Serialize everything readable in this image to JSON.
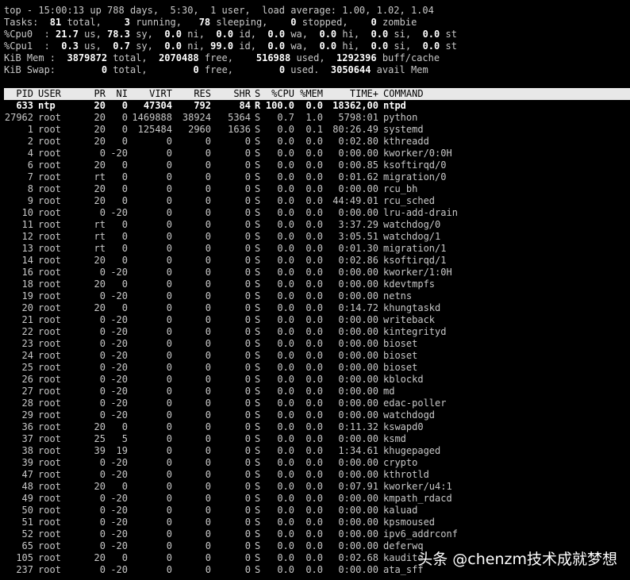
{
  "summary": [
    [
      {
        "t": "top - 15:00:13 up 788 days,  5:30,  1 user,  load average: 1.00, 1.02, 1.04"
      }
    ],
    [
      {
        "t": "Tasks: "
      },
      {
        "t": " 81",
        "b": 1
      },
      {
        "t": " total,  "
      },
      {
        "t": "  3",
        "b": 1
      },
      {
        "t": " running,  "
      },
      {
        "t": " 78",
        "b": 1
      },
      {
        "t": " sleeping,  "
      },
      {
        "t": "  0",
        "b": 1
      },
      {
        "t": " stopped,  "
      },
      {
        "t": "  0",
        "b": 1
      },
      {
        "t": " zombie"
      }
    ],
    [
      {
        "t": "%Cpu0  : "
      },
      {
        "t": "21.7",
        "b": 1
      },
      {
        "t": " us, "
      },
      {
        "t": "78.3",
        "b": 1
      },
      {
        "t": " sy,  "
      },
      {
        "t": "0.0",
        "b": 1
      },
      {
        "t": " ni,  "
      },
      {
        "t": "0.0",
        "b": 1
      },
      {
        "t": " id,  "
      },
      {
        "t": "0.0",
        "b": 1
      },
      {
        "t": " wa,  "
      },
      {
        "t": "0.0",
        "b": 1
      },
      {
        "t": " hi,  "
      },
      {
        "t": "0.0",
        "b": 1
      },
      {
        "t": " si,  "
      },
      {
        "t": "0.0",
        "b": 1
      },
      {
        "t": " st"
      }
    ],
    [
      {
        "t": "%Cpu1  :  "
      },
      {
        "t": "0.3",
        "b": 1
      },
      {
        "t": " us,  "
      },
      {
        "t": "0.7",
        "b": 1
      },
      {
        "t": " sy,  "
      },
      {
        "t": "0.0",
        "b": 1
      },
      {
        "t": " ni, "
      },
      {
        "t": "99.0",
        "b": 1
      },
      {
        "t": " id,  "
      },
      {
        "t": "0.0",
        "b": 1
      },
      {
        "t": " wa,  "
      },
      {
        "t": "0.0",
        "b": 1
      },
      {
        "t": " hi,  "
      },
      {
        "t": "0.0",
        "b": 1
      },
      {
        "t": " si,  "
      },
      {
        "t": "0.0",
        "b": 1
      },
      {
        "t": " st"
      }
    ],
    [
      {
        "t": "KiB Mem : "
      },
      {
        "t": " 3879872",
        "b": 1
      },
      {
        "t": " total, "
      },
      {
        "t": " 2070488",
        "b": 1
      },
      {
        "t": " free,  "
      },
      {
        "t": "  516988",
        "b": 1
      },
      {
        "t": " used, "
      },
      {
        "t": " 1292396",
        "b": 1
      },
      {
        "t": " buff/cache"
      }
    ],
    [
      {
        "t": "KiB Swap:        "
      },
      {
        "t": "0",
        "b": 1
      },
      {
        "t": " total,        "
      },
      {
        "t": "0",
        "b": 1
      },
      {
        "t": " free,        "
      },
      {
        "t": "0",
        "b": 1
      },
      {
        "t": " used. "
      },
      {
        "t": " 3050644",
        "b": 1
      },
      {
        "t": " avail Mem"
      }
    ]
  ],
  "columns": [
    "PID",
    "USER",
    "PR",
    "NI",
    "VIRT",
    "RES",
    "SHR",
    "S",
    "%CPU",
    "%MEM",
    "TIME+",
    "COMMAND"
  ],
  "processes": [
    [
      "633",
      "ntp",
      "20",
      "0",
      "47304",
      "792",
      "84",
      "R",
      "100.0",
      "0.0",
      "18362,00",
      "ntpd"
    ],
    [
      "27962",
      "root",
      "20",
      "0",
      "1469888",
      "38924",
      "5364",
      "S",
      "0.7",
      "1.0",
      "5798:01",
      "python"
    ],
    [
      "1",
      "root",
      "20",
      "0",
      "125484",
      "2960",
      "1636",
      "S",
      "0.0",
      "0.1",
      "80:26.49",
      "systemd"
    ],
    [
      "2",
      "root",
      "20",
      "0",
      "0",
      "0",
      "0",
      "S",
      "0.0",
      "0.0",
      "0:02.80",
      "kthreadd"
    ],
    [
      "4",
      "root",
      "0",
      "-20",
      "0",
      "0",
      "0",
      "S",
      "0.0",
      "0.0",
      "0:00.00",
      "kworker/0:0H"
    ],
    [
      "6",
      "root",
      "20",
      "0",
      "0",
      "0",
      "0",
      "S",
      "0.0",
      "0.0",
      "0:00.85",
      "ksoftirqd/0"
    ],
    [
      "7",
      "root",
      "rt",
      "0",
      "0",
      "0",
      "0",
      "S",
      "0.0",
      "0.0",
      "0:01.62",
      "migration/0"
    ],
    [
      "8",
      "root",
      "20",
      "0",
      "0",
      "0",
      "0",
      "S",
      "0.0",
      "0.0",
      "0:00.00",
      "rcu_bh"
    ],
    [
      "9",
      "root",
      "20",
      "0",
      "0",
      "0",
      "0",
      "S",
      "0.0",
      "0.0",
      "44:49.01",
      "rcu_sched"
    ],
    [
      "10",
      "root",
      "0",
      "-20",
      "0",
      "0",
      "0",
      "S",
      "0.0",
      "0.0",
      "0:00.00",
      "lru-add-drain"
    ],
    [
      "11",
      "root",
      "rt",
      "0",
      "0",
      "0",
      "0",
      "S",
      "0.0",
      "0.0",
      "3:37.29",
      "watchdog/0"
    ],
    [
      "12",
      "root",
      "rt",
      "0",
      "0",
      "0",
      "0",
      "S",
      "0.0",
      "0.0",
      "3:05.51",
      "watchdog/1"
    ],
    [
      "13",
      "root",
      "rt",
      "0",
      "0",
      "0",
      "0",
      "S",
      "0.0",
      "0.0",
      "0:01.30",
      "migration/1"
    ],
    [
      "14",
      "root",
      "20",
      "0",
      "0",
      "0",
      "0",
      "S",
      "0.0",
      "0.0",
      "0:02.86",
      "ksoftirqd/1"
    ],
    [
      "16",
      "root",
      "0",
      "-20",
      "0",
      "0",
      "0",
      "S",
      "0.0",
      "0.0",
      "0:00.00",
      "kworker/1:0H"
    ],
    [
      "18",
      "root",
      "20",
      "0",
      "0",
      "0",
      "0",
      "S",
      "0.0",
      "0.0",
      "0:00.00",
      "kdevtmpfs"
    ],
    [
      "19",
      "root",
      "0",
      "-20",
      "0",
      "0",
      "0",
      "S",
      "0.0",
      "0.0",
      "0:00.00",
      "netns"
    ],
    [
      "20",
      "root",
      "20",
      "0",
      "0",
      "0",
      "0",
      "S",
      "0.0",
      "0.0",
      "0:14.72",
      "khungtaskd"
    ],
    [
      "21",
      "root",
      "0",
      "-20",
      "0",
      "0",
      "0",
      "S",
      "0.0",
      "0.0",
      "0:00.00",
      "writeback"
    ],
    [
      "22",
      "root",
      "0",
      "-20",
      "0",
      "0",
      "0",
      "S",
      "0.0",
      "0.0",
      "0:00.00",
      "kintegrityd"
    ],
    [
      "23",
      "root",
      "0",
      "-20",
      "0",
      "0",
      "0",
      "S",
      "0.0",
      "0.0",
      "0:00.00",
      "bioset"
    ],
    [
      "24",
      "root",
      "0",
      "-20",
      "0",
      "0",
      "0",
      "S",
      "0.0",
      "0.0",
      "0:00.00",
      "bioset"
    ],
    [
      "25",
      "root",
      "0",
      "-20",
      "0",
      "0",
      "0",
      "S",
      "0.0",
      "0.0",
      "0:00.00",
      "bioset"
    ],
    [
      "26",
      "root",
      "0",
      "-20",
      "0",
      "0",
      "0",
      "S",
      "0.0",
      "0.0",
      "0:00.00",
      "kblockd"
    ],
    [
      "27",
      "root",
      "0",
      "-20",
      "0",
      "0",
      "0",
      "S",
      "0.0",
      "0.0",
      "0:00.00",
      "md"
    ],
    [
      "28",
      "root",
      "0",
      "-20",
      "0",
      "0",
      "0",
      "S",
      "0.0",
      "0.0",
      "0:00.00",
      "edac-poller"
    ],
    [
      "29",
      "root",
      "0",
      "-20",
      "0",
      "0",
      "0",
      "S",
      "0.0",
      "0.0",
      "0:00.00",
      "watchdogd"
    ],
    [
      "36",
      "root",
      "20",
      "0",
      "0",
      "0",
      "0",
      "S",
      "0.0",
      "0.0",
      "0:11.32",
      "kswapd0"
    ],
    [
      "37",
      "root",
      "25",
      "5",
      "0",
      "0",
      "0",
      "S",
      "0.0",
      "0.0",
      "0:00.00",
      "ksmd"
    ],
    [
      "38",
      "root",
      "39",
      "19",
      "0",
      "0",
      "0",
      "S",
      "0.0",
      "0.0",
      "1:34.61",
      "khugepaged"
    ],
    [
      "39",
      "root",
      "0",
      "-20",
      "0",
      "0",
      "0",
      "S",
      "0.0",
      "0.0",
      "0:00.00",
      "crypto"
    ],
    [
      "47",
      "root",
      "0",
      "-20",
      "0",
      "0",
      "0",
      "S",
      "0.0",
      "0.0",
      "0:00.00",
      "kthrotld"
    ],
    [
      "48",
      "root",
      "20",
      "0",
      "0",
      "0",
      "0",
      "S",
      "0.0",
      "0.0",
      "0:07.91",
      "kworker/u4:1"
    ],
    [
      "49",
      "root",
      "0",
      "-20",
      "0",
      "0",
      "0",
      "S",
      "0.0",
      "0.0",
      "0:00.00",
      "kmpath_rdacd"
    ],
    [
      "50",
      "root",
      "0",
      "-20",
      "0",
      "0",
      "0",
      "S",
      "0.0",
      "0.0",
      "0:00.00",
      "kaluad"
    ],
    [
      "51",
      "root",
      "0",
      "-20",
      "0",
      "0",
      "0",
      "S",
      "0.0",
      "0.0",
      "0:00.00",
      "kpsmoused"
    ],
    [
      "52",
      "root",
      "0",
      "-20",
      "0",
      "0",
      "0",
      "S",
      "0.0",
      "0.0",
      "0:00.00",
      "ipv6_addrconf"
    ],
    [
      "65",
      "root",
      "0",
      "-20",
      "0",
      "0",
      "0",
      "S",
      "0.0",
      "0.0",
      "0:00.00",
      "deferwq"
    ],
    [
      "105",
      "root",
      "20",
      "0",
      "0",
      "0",
      "0",
      "S",
      "0.0",
      "0.0",
      "0:02.68",
      "kauditd"
    ],
    [
      "237",
      "root",
      "0",
      "-20",
      "0",
      "0",
      "0",
      "S",
      "0.0",
      "0.0",
      "0:00.00",
      "ata_sff"
    ]
  ],
  "watermark": "头条 @chenzm技术成就梦想"
}
